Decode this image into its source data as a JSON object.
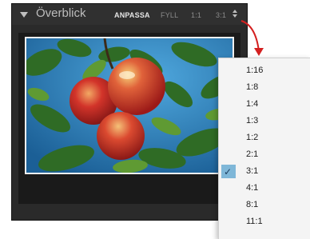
{
  "navigator": {
    "title": "Överblick",
    "zoom_options": [
      "ANPASSA",
      "FYLL",
      "1:1",
      "3:1"
    ],
    "active_option": "ANPASSA"
  },
  "zoom_menu": {
    "items": [
      "1:16",
      "1:8",
      "1:4",
      "1:3",
      "1:2",
      "2:1",
      "3:1",
      "4:1",
      "8:1",
      "11:1"
    ],
    "selected": "3:1",
    "check_glyph": "✓"
  },
  "icons": {
    "collapse": "disclosure-triangle-icon",
    "stepper": "up-down-arrows-icon",
    "callout": "red-curved-arrow-icon",
    "check": "checkmark-icon"
  },
  "colors": {
    "panel_bg": "#2a2a2a",
    "menu_bg": "#f4f4f4",
    "selection": "#7fb7d8",
    "arrow": "#d42020"
  }
}
